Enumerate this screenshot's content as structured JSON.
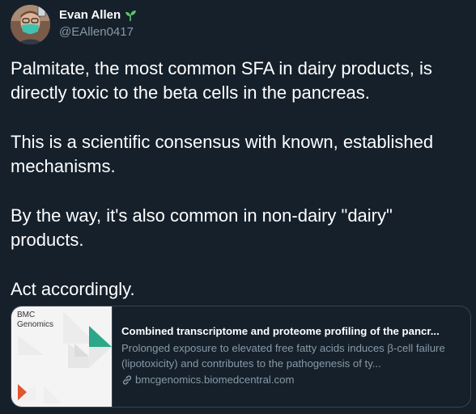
{
  "author": {
    "name": "Evan Allen",
    "handle": "@EAllen0417",
    "name_icon": "sprout-icon",
    "avatar_icon": "avatar-masked-person"
  },
  "tweet": {
    "paragraphs": [
      "Palmitate, the most common SFA in dairy products, is directly toxic to the beta cells in the pancreas.",
      "This is a scientific consensus with known, established mechanisms.",
      "By the way, it's also common in non-dairy \"dairy\" products.",
      "Act accordingly."
    ]
  },
  "card": {
    "thumbnail_brand": "BMC\nGenomics",
    "title": "Combined transcriptome and proteome profiling of the pancr...",
    "description": "Prolonged exposure to elevated free fatty acids induces β-cell failure (lipotoxicity) and contributes to the pathogenesis of ty...",
    "domain": "bmcgenomics.biomedcentral.com",
    "domain_icon": "link-icon"
  },
  "colors": {
    "background": "#15202b",
    "text_primary": "#ffffff",
    "text_secondary": "#8899a6",
    "border": "#38444d",
    "accent_teal": "#2aa888",
    "accent_orange": "#e2552d",
    "sprout_green": "#5fc56b"
  }
}
